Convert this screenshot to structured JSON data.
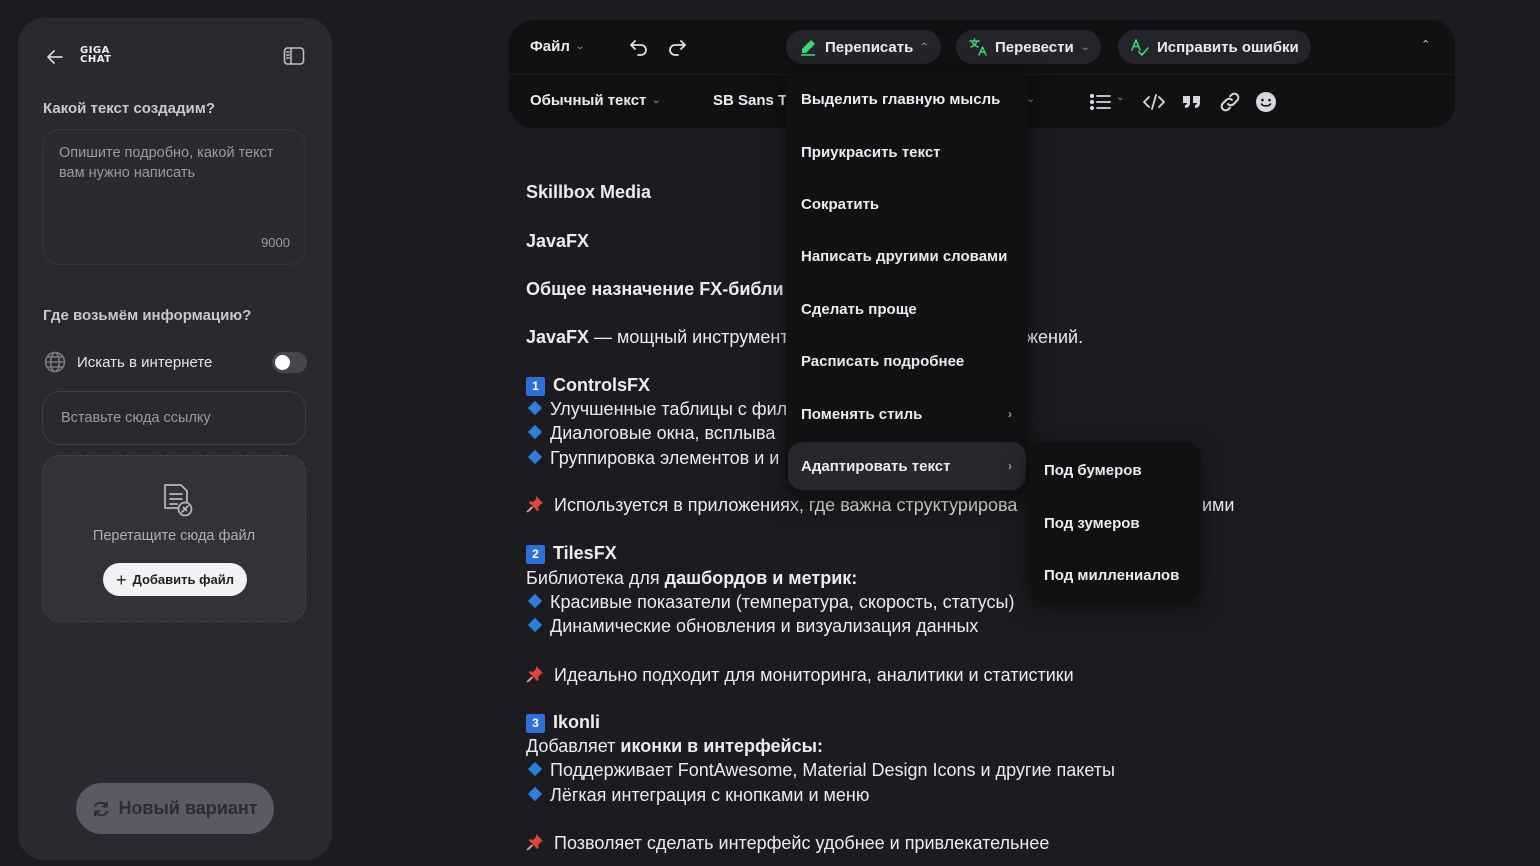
{
  "sidebar": {
    "logo_top": "GIGA",
    "logo_bottom": "CHAT",
    "question_heading": "Какой текст создадим?",
    "textarea_placeholder": "Опишите подробно, какой текст вам нужно написать",
    "char_limit": "9000",
    "info_heading": "Где возьмём информацию?",
    "web_search_label": "Искать в интернете",
    "web_search_enabled": false,
    "link_placeholder": "Вставьте сюда ссылку",
    "drop_label": "Перетащите сюда файл",
    "add_file_label": "Добавить файл",
    "new_variant_label": "Новый вариант"
  },
  "toolbar": {
    "file_label": "Файл",
    "rewrite_label": "Переписать",
    "translate_label": "Перевести",
    "fix_label": "Исправить ошибки",
    "style_label": "Обычный текст",
    "font_label": "SB Sans T"
  },
  "rewrite_menu": [
    {
      "label": "Выделить главную мысль",
      "submenu": false
    },
    {
      "label": "Приукрасить текст",
      "submenu": false
    },
    {
      "label": "Сократить",
      "submenu": false
    },
    {
      "label": "Написать другими словами",
      "submenu": false
    },
    {
      "label": "Сделать проще",
      "submenu": false
    },
    {
      "label": "Расписать подробнее",
      "submenu": false
    },
    {
      "label": "Поменять стиль",
      "submenu": true
    },
    {
      "label": "Адаптировать текст",
      "submenu": true,
      "active": true
    }
  ],
  "adapt_submenu": [
    "Под бумеров",
    "Под зумеров",
    "Под миллениалов"
  ],
  "document": {
    "l1": "Skillbox Media",
    "l2": "JavaFX",
    "l3": "Общее назначение FX-библи",
    "l4_bold": "JavaFX",
    "l4_rest": " — мощный инструмент",
    "l4_tail": "жений.",
    "s1_num": "1",
    "s1_title": "ControlsFX",
    "s1_b1": "Улучшенные таблицы с фил",
    "s1_b2": "Диалоговые окна, всплыва",
    "s1_b3": "Группировка элементов и и",
    "s1_pin": "Используется в приложениях, где важна структурирова",
    "s1_pin_tail": "ими",
    "s2_num": "2",
    "s2_title": "TilesFX",
    "s2_intro_pre": "Библиотека для ",
    "s2_intro_bold": "дашбордов и метрик:",
    "s2_b1": "Красивые показатели (температура, скорость, статусы)",
    "s2_b2": "Динамические обновления и визуализация данных",
    "s2_pin": "Идеально подходит для мониторинга, аналитики и статистики",
    "s3_num": "3",
    "s3_title": "Ikonli",
    "s3_intro_pre": "Добавляет ",
    "s3_intro_bold": "иконки в интерфейсы:",
    "s3_b1": "Поддерживает FontAwesome, Material Design Icons и другие пакеты",
    "s3_b2": "Лёгкая интеграция с кнопками и меню",
    "s3_pin": "Позволяет сделать интерфейс удобнее и привлекательнее"
  },
  "colors": {
    "accent_green": "#3ed67a",
    "number_badge": "#2f6fd8",
    "diamond": "#2f7fe0",
    "pin": "#e0463a"
  }
}
